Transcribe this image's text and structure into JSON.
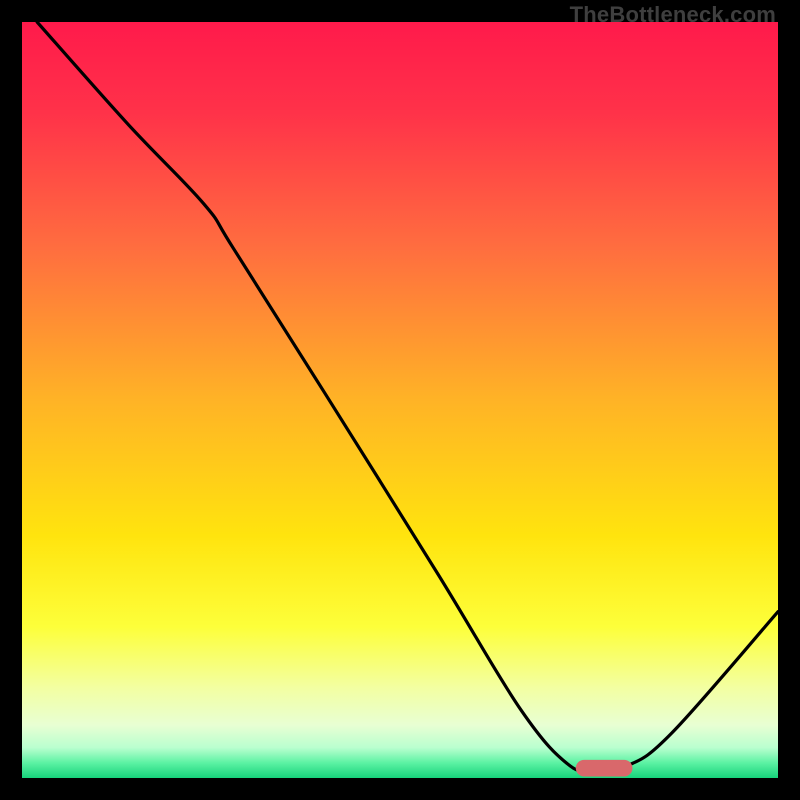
{
  "watermark": "TheBottleneck.com",
  "chart_data": {
    "type": "line",
    "title": "",
    "xlabel": "",
    "ylabel": "",
    "xlim": [
      0,
      100
    ],
    "ylim": [
      0,
      100
    ],
    "grid": false,
    "legend": false,
    "curve_points": [
      {
        "x": 2.0,
        "y": 100.0
      },
      {
        "x": 14.0,
        "y": 86.5
      },
      {
        "x": 24.0,
        "y": 76.0
      },
      {
        "x": 28.0,
        "y": 70.0
      },
      {
        "x": 40.0,
        "y": 51.0
      },
      {
        "x": 55.0,
        "y": 27.0
      },
      {
        "x": 66.0,
        "y": 9.0
      },
      {
        "x": 72.5,
        "y": 1.6
      },
      {
        "x": 76.0,
        "y": 1.3
      },
      {
        "x": 80.0,
        "y": 1.6
      },
      {
        "x": 86.0,
        "y": 6.0
      },
      {
        "x": 100.0,
        "y": 22.0
      }
    ],
    "marker": {
      "x_center": 77.0,
      "y": 1.3,
      "width": 7.5,
      "height": 2.2,
      "color": "#d9686b"
    },
    "gradient_stops": [
      {
        "pct": 0,
        "color": "#ff1a4b"
      },
      {
        "pct": 12,
        "color": "#ff3249"
      },
      {
        "pct": 30,
        "color": "#ff6e3f"
      },
      {
        "pct": 50,
        "color": "#ffb326"
      },
      {
        "pct": 68,
        "color": "#ffe40e"
      },
      {
        "pct": 80,
        "color": "#fdff3a"
      },
      {
        "pct": 88,
        "color": "#f3ffa1"
      },
      {
        "pct": 93,
        "color": "#e8ffd3"
      },
      {
        "pct": 96,
        "color": "#b9ffcf"
      },
      {
        "pct": 98,
        "color": "#5cf2a3"
      },
      {
        "pct": 100,
        "color": "#17d37b"
      }
    ]
  }
}
